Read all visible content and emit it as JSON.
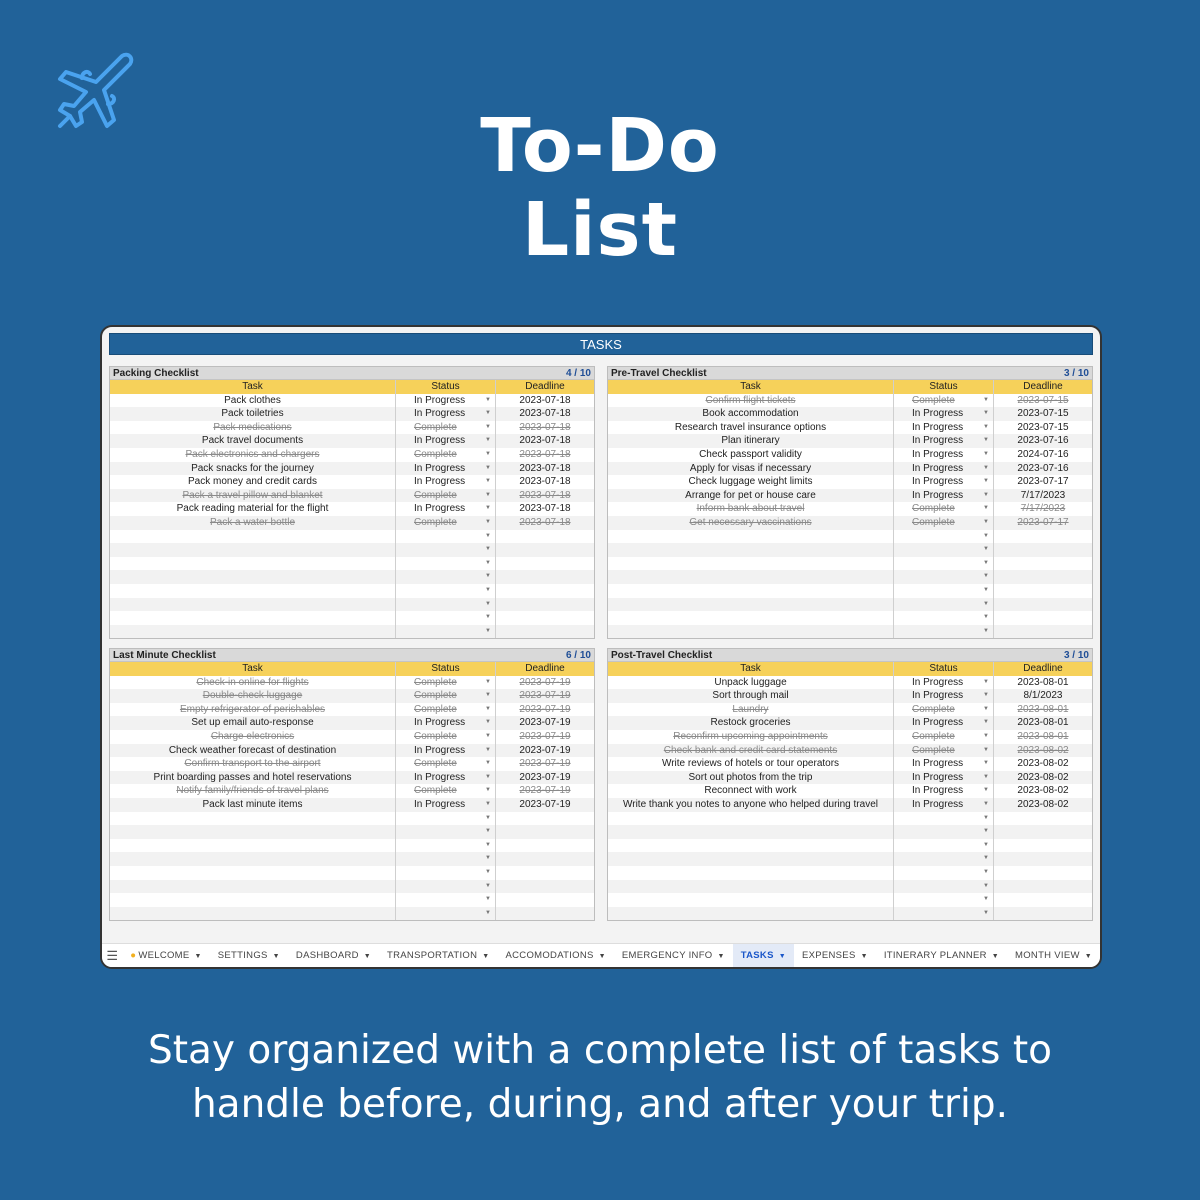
{
  "page": {
    "title_line1": "To-Do",
    "title_line2": "List",
    "tagline_line1": "Stay organized with a complete list of tasks to",
    "tagline_line2": "handle before, during, and after your trip.",
    "logo_icon": "airplane-icon",
    "background_color": "#216299",
    "logo_color": "#4aa3ef"
  },
  "sheet": {
    "banner": "TASKS",
    "columns": {
      "task": "Task",
      "status": "Status",
      "deadline": "Deadline"
    },
    "empty_rows": 8,
    "colors": {
      "header_yellow": "#f6d15a",
      "banner_blue": "#216299",
      "count_blue": "#1f4e96"
    },
    "checklists": [
      {
        "title": "Packing Checklist",
        "count": "4 / 10",
        "rows": [
          {
            "task": "Pack clothes",
            "status": "In Progress",
            "deadline": "2023-07-18",
            "done": false
          },
          {
            "task": "Pack toiletries",
            "status": "In Progress",
            "deadline": "2023-07-18",
            "done": false
          },
          {
            "task": "Pack medications",
            "status": "Complete",
            "deadline": "2023-07-18",
            "done": true
          },
          {
            "task": "Pack travel documents",
            "status": "In Progress",
            "deadline": "2023-07-18",
            "done": false
          },
          {
            "task": "Pack electronics and chargers",
            "status": "Complete",
            "deadline": "2023-07-18",
            "done": true
          },
          {
            "task": "Pack snacks for the journey",
            "status": "In Progress",
            "deadline": "2023-07-18",
            "done": false
          },
          {
            "task": "Pack money and credit cards",
            "status": "In Progress",
            "deadline": "2023-07-18",
            "done": false
          },
          {
            "task": "Pack a travel pillow and blanket",
            "status": "Complete",
            "deadline": "2023-07-18",
            "done": true
          },
          {
            "task": "Pack reading material for the flight",
            "status": "In Progress",
            "deadline": "2023-07-18",
            "done": false
          },
          {
            "task": "Pack a water bottle",
            "status": "Complete",
            "deadline": "2023-07-18",
            "done": true
          }
        ]
      },
      {
        "title": "Pre-Travel Checklist",
        "count": "3 / 10",
        "rows": [
          {
            "task": "Confirm flight tickets",
            "status": "Complete",
            "deadline": "2023-07-15",
            "done": true
          },
          {
            "task": "Book accommodation",
            "status": "In Progress",
            "deadline": "2023-07-15",
            "done": false
          },
          {
            "task": "Research travel insurance options",
            "status": "In Progress",
            "deadline": "2023-07-15",
            "done": false
          },
          {
            "task": "Plan itinerary",
            "status": "In Progress",
            "deadline": "2023-07-16",
            "done": false
          },
          {
            "task": "Check passport validity",
            "status": "In Progress",
            "deadline": "2024-07-16",
            "done": false
          },
          {
            "task": "Apply for visas if necessary",
            "status": "In Progress",
            "deadline": "2023-07-16",
            "done": false
          },
          {
            "task": "Check luggage weight limits",
            "status": "In Progress",
            "deadline": "2023-07-17",
            "done": false
          },
          {
            "task": "Arrange for pet or house care",
            "status": "In Progress",
            "deadline": "7/17/2023",
            "done": false
          },
          {
            "task": "Inform bank about travel",
            "status": "Complete",
            "deadline": "7/17/2023",
            "done": true
          },
          {
            "task": "Get necessary vaccinations",
            "status": "Complete",
            "deadline": "2023-07-17",
            "done": true
          }
        ]
      },
      {
        "title": "Last Minute Checklist",
        "count": "6 / 10",
        "rows": [
          {
            "task": "Check-in online for flights",
            "status": "Complete",
            "deadline": "2023-07-19",
            "done": true
          },
          {
            "task": "Double-check luggage",
            "status": "Complete",
            "deadline": "2023-07-19",
            "done": true
          },
          {
            "task": "Empty refrigerator of perishables",
            "status": "Complete",
            "deadline": "2023-07-19",
            "done": true
          },
          {
            "task": "Set up email auto-response",
            "status": "In Progress",
            "deadline": "2023-07-19",
            "done": false
          },
          {
            "task": "Charge electronics",
            "status": "Complete",
            "deadline": "2023-07-19",
            "done": true
          },
          {
            "task": "Check weather forecast of destination",
            "status": "In Progress",
            "deadline": "2023-07-19",
            "done": false
          },
          {
            "task": "Confirm transport to the airport",
            "status": "Complete",
            "deadline": "2023-07-19",
            "done": true
          },
          {
            "task": "Print boarding passes and hotel reservations",
            "status": "In Progress",
            "deadline": "2023-07-19",
            "done": false
          },
          {
            "task": "Notify family/friends of travel plans",
            "status": "Complete",
            "deadline": "2023-07-19",
            "done": true
          },
          {
            "task": "Pack last minute items",
            "status": "In Progress",
            "deadline": "2023-07-19",
            "done": false
          }
        ]
      },
      {
        "title": "Post-Travel Checklist",
        "count": "3 / 10",
        "rows": [
          {
            "task": "Unpack luggage",
            "status": "In Progress",
            "deadline": "2023-08-01",
            "done": false
          },
          {
            "task": "Sort through mail",
            "status": "In Progress",
            "deadline": "8/1/2023",
            "done": false
          },
          {
            "task": "Laundry",
            "status": "Complete",
            "deadline": "2023-08-01",
            "done": true
          },
          {
            "task": "Restock groceries",
            "status": "In Progress",
            "deadline": "2023-08-01",
            "done": false
          },
          {
            "task": "Reconfirm upcoming appointments",
            "status": "Complete",
            "deadline": "2023-08-01",
            "done": true
          },
          {
            "task": "Check bank and credit card statements",
            "status": "Complete",
            "deadline": "2023-08-02",
            "done": true
          },
          {
            "task": "Write reviews of hotels or tour operators",
            "status": "In Progress",
            "deadline": "2023-08-02",
            "done": false
          },
          {
            "task": "Sort out photos from the trip",
            "status": "In Progress",
            "deadline": "2023-08-02",
            "done": false
          },
          {
            "task": "Reconnect with work",
            "status": "In Progress",
            "deadline": "2023-08-02",
            "done": false
          },
          {
            "task": "Write thank you notes to anyone who helped during travel",
            "status": "In Progress",
            "deadline": "2023-08-02",
            "done": false
          }
        ]
      }
    ]
  },
  "tabs": {
    "menu_icon": "hamburger-menu-icon",
    "items": [
      {
        "label": "WELCOME",
        "icon": "waving-hand-icon",
        "active": false
      },
      {
        "label": "SETTINGS",
        "active": false
      },
      {
        "label": "DASHBOARD",
        "active": false
      },
      {
        "label": "TRANSPORTATION",
        "active": false
      },
      {
        "label": "ACCOMODATIONS",
        "active": false
      },
      {
        "label": "EMERGENCY INFO",
        "active": false
      },
      {
        "label": "TASKS",
        "active": true
      },
      {
        "label": "EXPENSES",
        "active": false
      },
      {
        "label": "ITINERARY PLANNER",
        "active": false
      },
      {
        "label": "MONTH VIEW",
        "active": false
      }
    ]
  }
}
